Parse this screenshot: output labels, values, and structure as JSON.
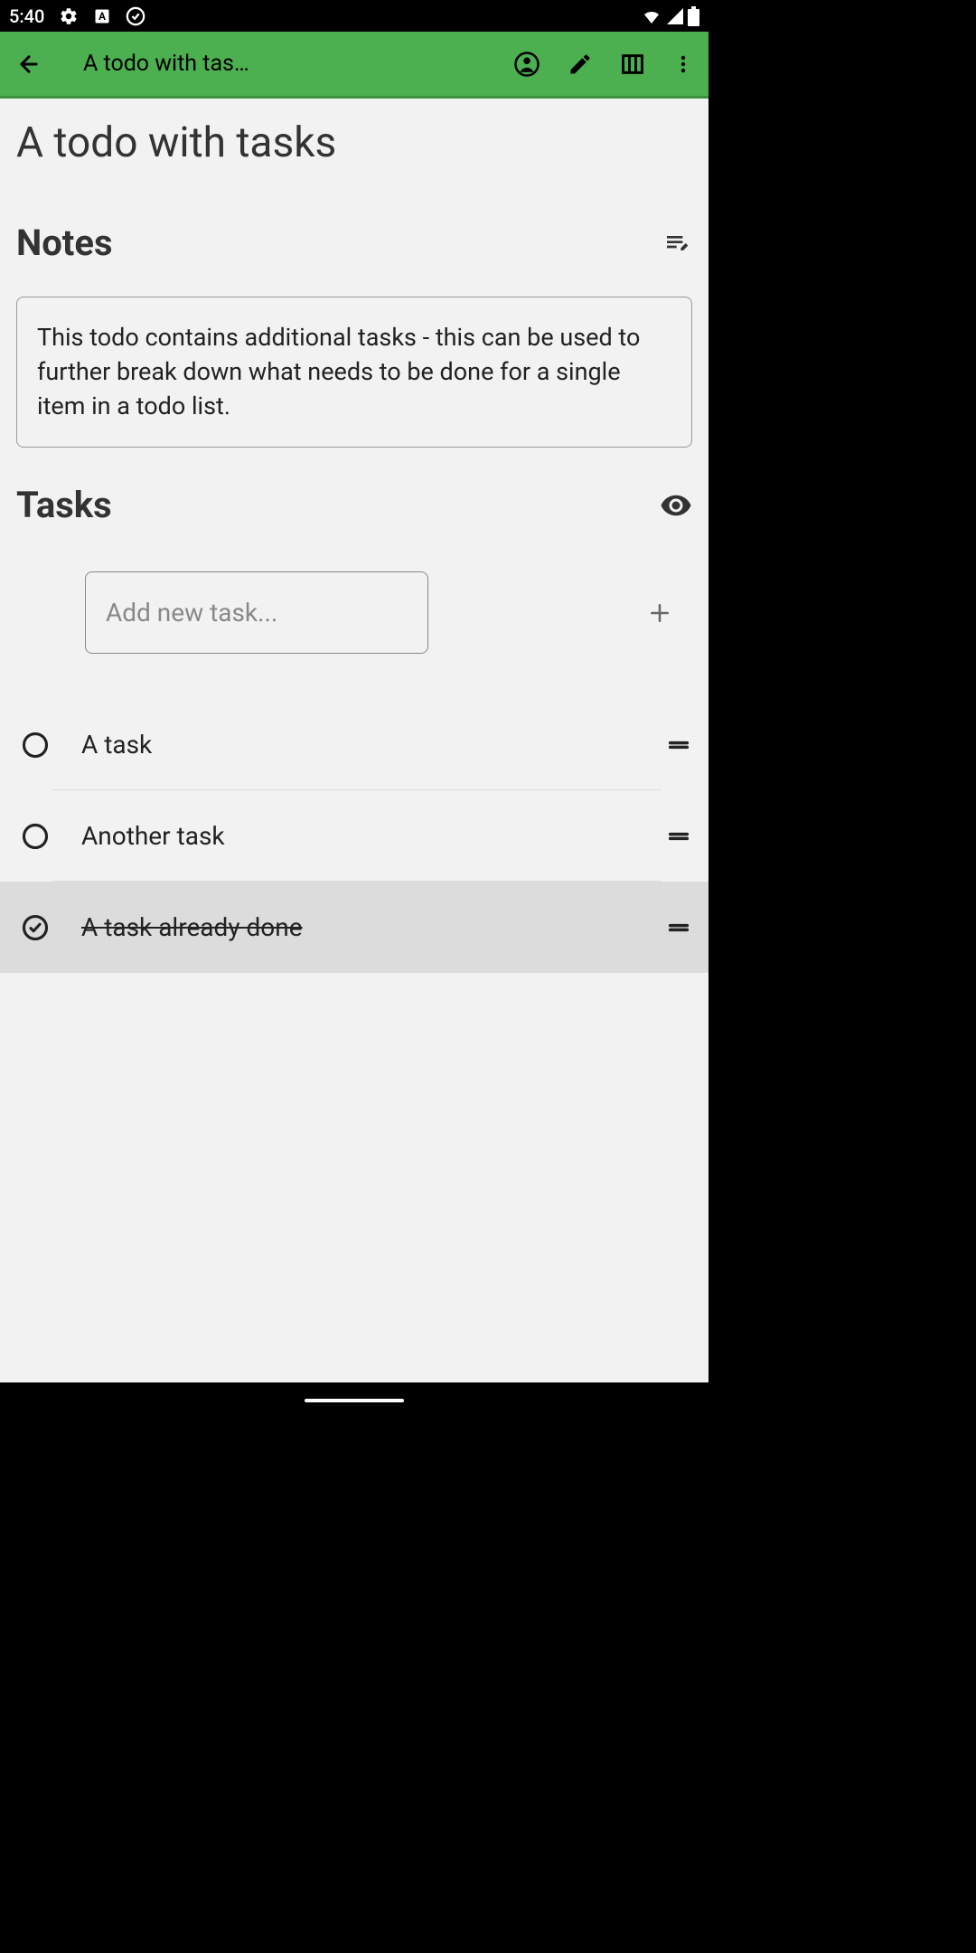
{
  "status": {
    "time": "5:40"
  },
  "appbar": {
    "title": "A todo with tas…"
  },
  "page": {
    "title": "A todo with tasks"
  },
  "notes": {
    "heading": "Notes",
    "content": "This todo contains additional tasks - this can be used to further break down what needs to be done for a single item in a todo list."
  },
  "tasks": {
    "heading": "Tasks",
    "placeholder": "Add new task...",
    "items": [
      {
        "label": "A task",
        "done": false
      },
      {
        "label": "Another task",
        "done": false
      },
      {
        "label": "A task already done",
        "done": true
      }
    ]
  }
}
